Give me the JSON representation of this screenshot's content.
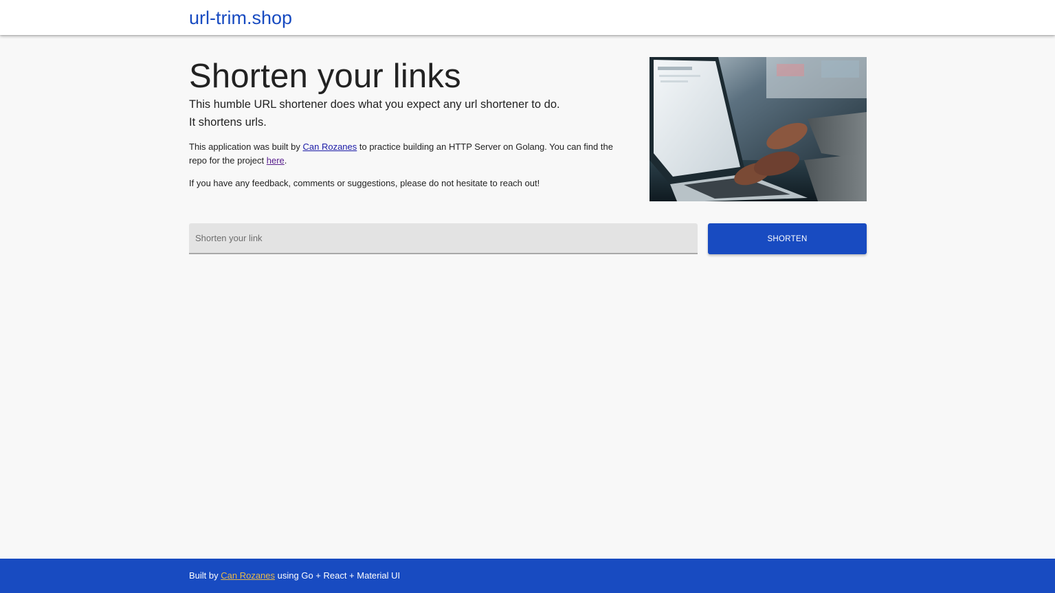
{
  "header": {
    "brand": "url-trim.shop"
  },
  "intro": {
    "title": "Shorten your links",
    "lead_line1": "This humble URL shortener does what you expect any url shortener to do.",
    "lead_line2": "It shortens urls.",
    "about_prefix": "This application was built by ",
    "author_link": "Can Rozanes",
    "about_middle": " to practice building an HTTP Server on Golang. You can find the repo for the project ",
    "repo_link": "here",
    "about_suffix": ".",
    "feedback": "If you have any feedback, comments or suggestions, please do not hesitate to reach out!"
  },
  "hero_image": {
    "icon": "laptop-typing-photo"
  },
  "form": {
    "placeholder": "Shorten your link",
    "value": "",
    "button_label": "SHORTEN"
  },
  "footer": {
    "prefix": "Built by ",
    "author_link": "Can Rozanes",
    "suffix": " using Go + React + Material UI"
  },
  "colors": {
    "primary": "#184bc1",
    "footer_link": "#e9b949",
    "background": "#f8f8f8",
    "input_background": "#e3e3e3"
  }
}
